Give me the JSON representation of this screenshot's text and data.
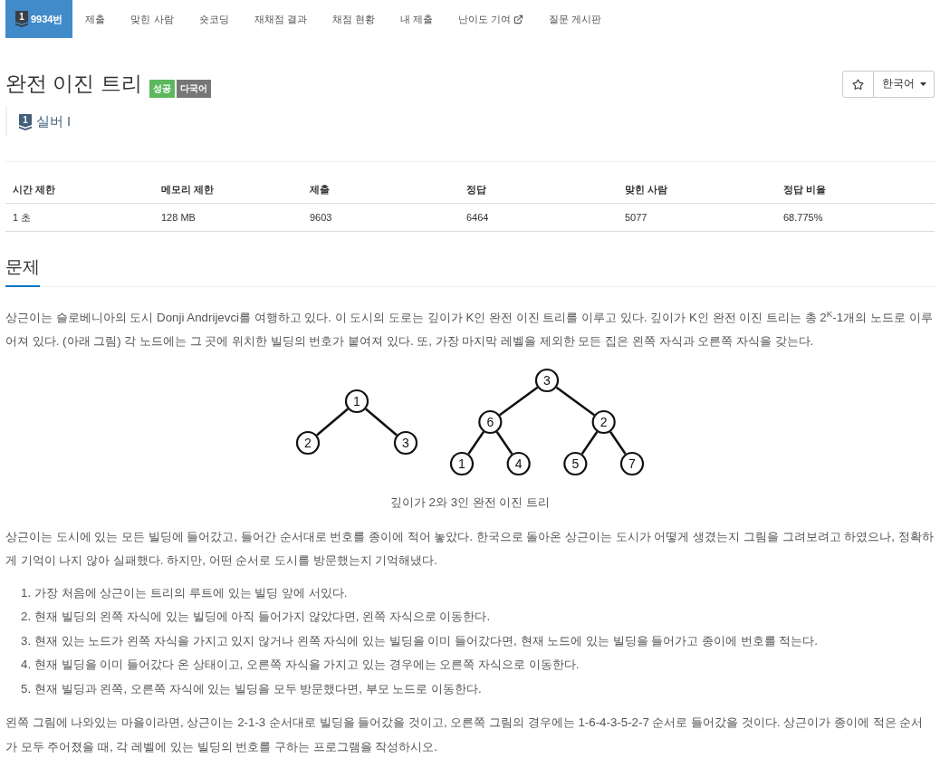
{
  "nav": {
    "tabs": [
      {
        "label": "9934번",
        "badge": "1",
        "selected": true,
        "external": false
      },
      {
        "label": "제출",
        "selected": false,
        "external": false
      },
      {
        "label": "맞힌 사람",
        "selected": false,
        "external": false
      },
      {
        "label": "숏코딩",
        "selected": false,
        "external": false
      },
      {
        "label": "재채점 결과",
        "selected": false,
        "external": false
      },
      {
        "label": "채점 현황",
        "selected": false,
        "external": false
      },
      {
        "label": "내 제출",
        "selected": false,
        "external": false
      },
      {
        "label": "난이도 기여",
        "selected": false,
        "external": true
      },
      {
        "label": "질문 게시판",
        "selected": false,
        "external": false
      }
    ]
  },
  "problem": {
    "title": "완전 이진 트리",
    "labels": [
      {
        "text": "성공",
        "color": "#5cb85c"
      },
      {
        "text": "다국어",
        "color": "#777777"
      }
    ],
    "tier": {
      "badge": "1",
      "name": "실버 I"
    }
  },
  "actions": {
    "starred": false,
    "language": "한국어"
  },
  "limits_table": {
    "columns": [
      "시간 제한",
      "메모리 제한",
      "제출",
      "정답",
      "맞힌 사람",
      "정답 비율"
    ],
    "rows": [
      [
        "1 초",
        "128 MB",
        "9603",
        "6464",
        "5077",
        "68.775%"
      ]
    ]
  },
  "section": {
    "heading": "문제",
    "paragraph_1": "상근이는 슬로베니아의 도시 Donji Andrijevci를 여행하고 있다. 이 도시의 도로는 깊이가 K인 완전 이진 트리를 이루고 있다. 깊이가 K인 완전 이진 트리는 총 2$^{K}$-1개의 노드로 이루어져 있다. (아래 그림) 각 노드에는 그 곳에 위치한 빌딩의 번호가 붙여져 있다. 또, 가장 마지막 레벨을 제외한 모든 집은 왼쪽 자식과 오른쪽 자식을 갖는다.",
    "figure": {
      "trees": [
        {
          "label": "1",
          "children": [
            {
              "label": "2"
            },
            {
              "label": "3"
            }
          ]
        },
        {
          "label": "3",
          "children": [
            {
              "label": "6",
              "children": [
                {
                  "label": "1"
                },
                {
                  "label": "4"
                }
              ]
            },
            {
              "label": "2",
              "children": [
                {
                  "label": "5"
                },
                {
                  "label": "7"
                }
              ]
            }
          ]
        }
      ],
      "caption": "깊이가 2와 3인 완전 이진 트리"
    },
    "paragraph_2": "상근이는 도시에 있는 모든 빌딩에 들어갔고, 들어간 순서대로 번호를 종이에 적어 놓았다. 한국으로 돌아온 상근이는 도시가 어떻게 생겼는지 그림을 그려보려고 하였으나, 정확하게 기억이 나지 않아 실패했다. 하지만, 어떤 순서로 도시를 방문했는지 기억해냈다.",
    "steps": [
      {
        "number": "1.",
        "text": "가장 처음에 상근이는 트리의 루트에 있는 빌딩 앞에 서있다."
      },
      {
        "number": "2.",
        "text": "현재 빌딩의 왼쪽 자식에 있는 빌딩에 아직 들어가지 않았다면, 왼쪽 자식으로 이동한다."
      },
      {
        "number": "3.",
        "text": "현재 있는 노드가 왼쪽 자식을 가지고 있지 않거나 왼쪽 자식에 있는 빌딩을 이미 들어갔다면, 현재 노드에 있는 빌딩을 들어가고 종이에 번호를 적는다."
      },
      {
        "number": "4.",
        "text": "현재 빌딩을 이미 들어갔다 온 상태이고, 오른쪽 자식을 가지고 있는 경우에는 오른쪽 자식으로 이동한다."
      },
      {
        "number": "5.",
        "text": "현재 빌딩과 왼쪽, 오른쪽 자식에 있는 빌딩을 모두 방문했다면, 부모 노드로 이동한다."
      }
    ],
    "paragraph_3": "왼쪽 그림에 나와있는 마을이라면, 상근이는 2-1-3 순서대로 빌딩을 들어갔을 것이고, 오른쪽 그림의 경우에는 1-6-4-3-5-2-7 순서로 들어갔을 것이다. 상근이가 종이에 적은 순서가 모두 주어졌을 때, 각 레벨에 있는 빌딩의 번호를 구하는 프로그램을 작성하시오."
  }
}
